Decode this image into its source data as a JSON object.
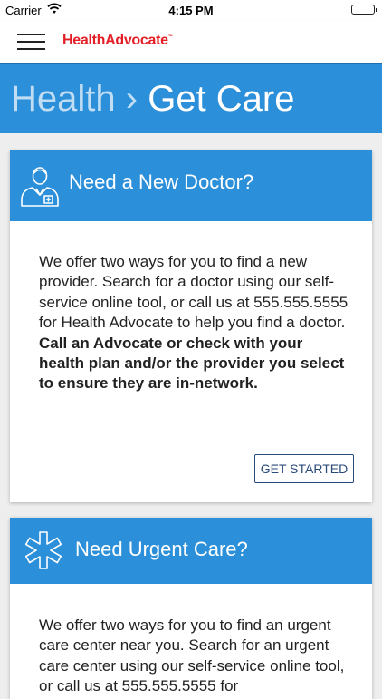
{
  "status_bar": {
    "carrier": "Carrier",
    "time": "4:15 PM",
    "wifi_icon": "wifi-icon",
    "battery_level": 1.0,
    "battery_color": "#3cc73c"
  },
  "header": {
    "menu_icon": "hamburger-menu-icon",
    "logo_text": "HealthAdvocate",
    "logo_mark": "™",
    "logo_color": "#e31e26"
  },
  "breadcrumb": {
    "parent": "Health",
    "separator": "›",
    "current": "Get Care"
  },
  "cards": [
    {
      "icon": "doctor-icon",
      "title": "Need a New Doctor?",
      "body_text": "We offer two ways for you to find a new provider. Search for a doctor using our self-service online tool, or call us at 555.555.5555 for Health Advocate to help you find a doctor. ",
      "body_bold": "Call an Advocate or check with your health plan and/or the provider you select to ensure they are in-network.",
      "button_label": "GET STARTED"
    },
    {
      "icon": "medical-star-icon",
      "title": "Need Urgent Care?",
      "body_text": "We offer two ways for you to find an urgent care center near you. Search for an urgent care center using our self-service online tool, or call us at 555.555.5555 for"
    }
  ],
  "colors": {
    "accent": "#2b8fd9",
    "button_border": "#2a4a7a",
    "background": "#eeeeee"
  }
}
